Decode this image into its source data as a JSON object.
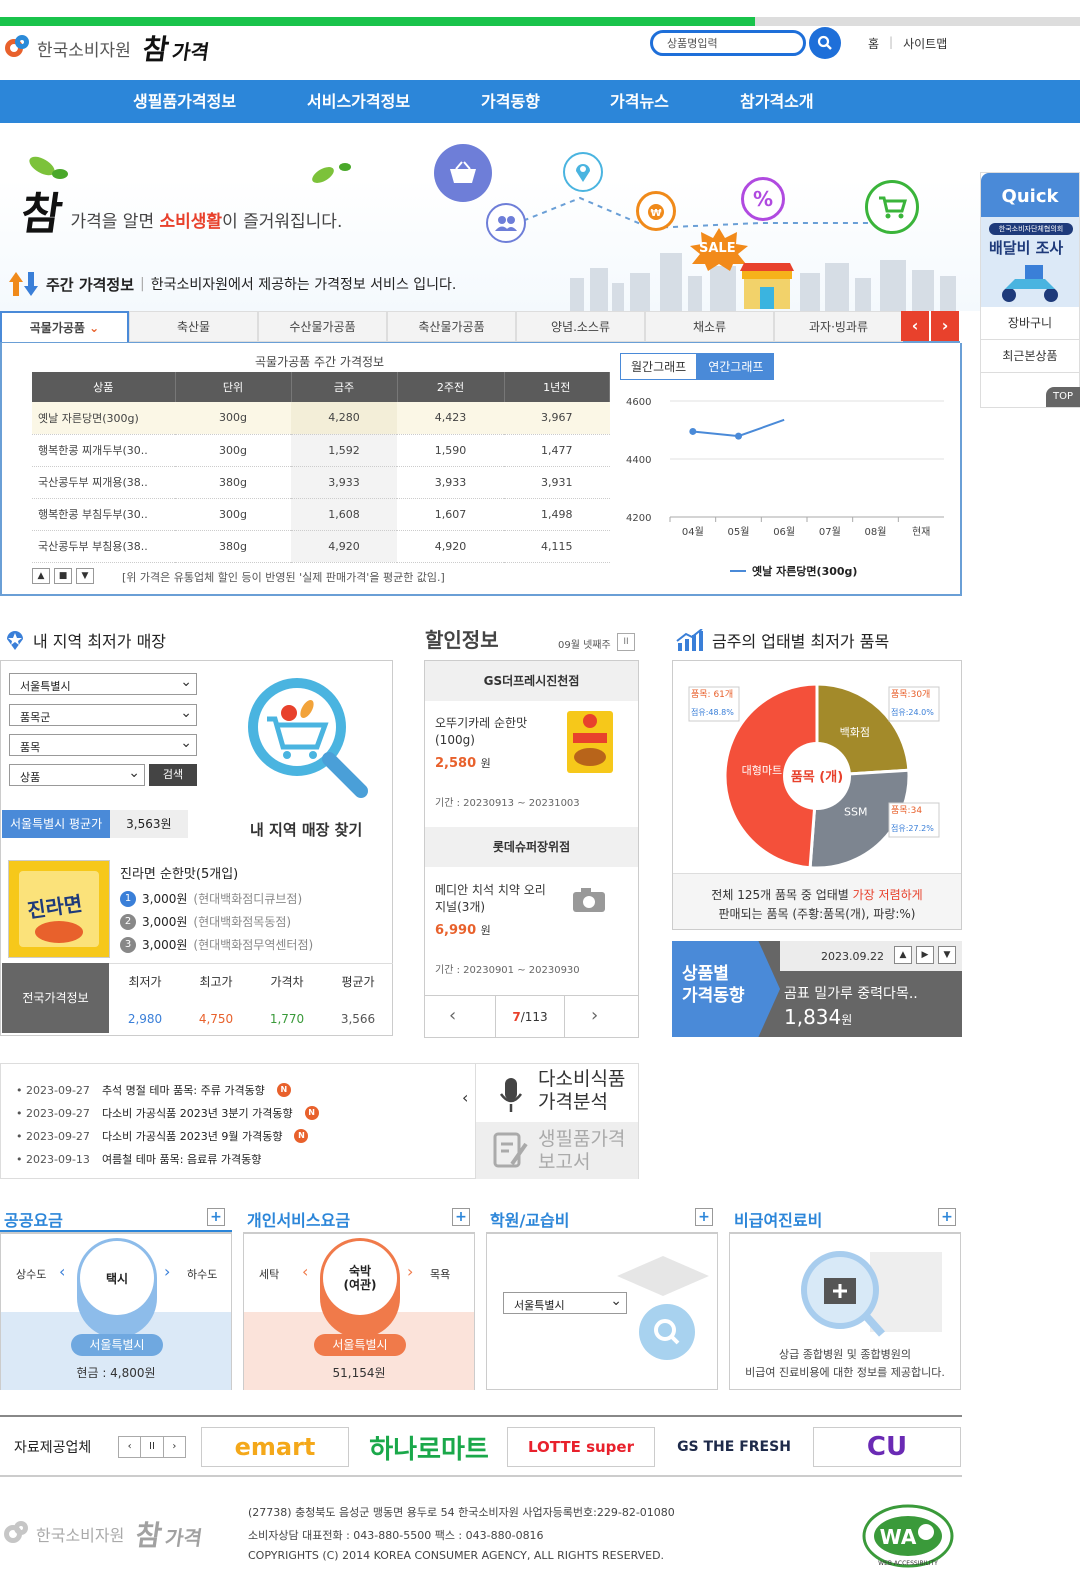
{
  "header": {
    "org_name": "한국소비자원",
    "brand_big": "참",
    "brand_small": "가격",
    "search_placeholder": "상품명입력",
    "links": [
      "홈",
      "사이트맵"
    ]
  },
  "gnb": [
    "생필품가격정보",
    "서비스가격정보",
    "가격동향",
    "가격뉴스",
    "참가격소개"
  ],
  "hero": {
    "slogan_big": "참",
    "slogan_pre": "가격을 알면 ",
    "slogan_em": "소비생활",
    "slogan_post": "이 즐거워집니다.",
    "sale_badge": "SALE",
    "icons": [
      "basket-icon",
      "map-pin-icon",
      "wallet-icon",
      "percent-icon",
      "cart-icon",
      "people-icon"
    ]
  },
  "weekly": {
    "title": "주간 가격정보",
    "desc": "한국소비자원에서 제공하는 가격정보 서비스 입니다."
  },
  "tabs": [
    "곡물가공품",
    "축산물",
    "수산물가공품",
    "축산물가공품",
    "양념.소스류",
    "채소류",
    "과자·빙과류"
  ],
  "price_table": {
    "title": "곡물가공품 주간 가격정보",
    "headers": [
      "상품",
      "단위",
      "금주",
      "2주전",
      "1년전"
    ],
    "rows": [
      [
        "옛날 자른당면(300g)",
        "300g",
        "4,280",
        "4,423",
        "3,967"
      ],
      [
        "행복한콩 찌개두부(30..",
        "300g",
        "1,592",
        "1,590",
        "1,477"
      ],
      [
        "국산콩두부 찌개용(38..",
        "380g",
        "3,933",
        "3,933",
        "3,931"
      ],
      [
        "행복한콩 부침두부(30..",
        "300g",
        "1,608",
        "1,607",
        "1,498"
      ],
      [
        "국산콩두부 부침용(38..",
        "380g",
        "4,920",
        "4,920",
        "4,115"
      ]
    ],
    "note": "[위 가격은 유통업체 할인 등이 반영된 '실제 판매가격'을 평균한 값임.]"
  },
  "graph_tabs": [
    "월간그래프",
    "연간그래프"
  ],
  "chart_data": {
    "type": "line",
    "categories": [
      "04월",
      "05월",
      "06월",
      "07월",
      "08월",
      "현재"
    ],
    "series": [
      {
        "name": "옛날 자른당면(300g)",
        "values": [
          4495,
          4479,
          4535,
          null,
          null,
          null
        ]
      }
    ],
    "yticks": [
      4600,
      4400,
      4200
    ],
    "ylim": [
      4200,
      4600
    ],
    "color": "#4a8ad8",
    "grid": true
  },
  "quick": {
    "title": "Quick",
    "banner_top": "한국소비자단체협의회",
    "banner_main": "배달비 조사",
    "items": [
      "장바구니",
      "최근본상품"
    ],
    "top": "TOP"
  },
  "region": {
    "title": "내 지역 최저가 매장",
    "selects": [
      "서울특별시",
      "품목군",
      "품목",
      "상품"
    ],
    "search_btn": "검색",
    "find_label": "내 지역 매장 찾기",
    "avg_label": "서울특별시 평균가",
    "avg_value": "3,563원",
    "product": "진라면 순한맛(5개입)",
    "pkg_text": "진라면",
    "ranks": [
      {
        "n": "1",
        "price": "3,000원",
        "store": "(현대백화점디큐브점)"
      },
      {
        "n": "2",
        "price": "3,000원",
        "store": "(현대백화점목동점)"
      },
      {
        "n": "3",
        "price": "3,000원",
        "store": "(현대백화점무역센터점)"
      }
    ],
    "nat_label": "전국가격정보",
    "nat_cols": [
      {
        "h": "최저가",
        "v": "2,980",
        "c": "#3a7fd8"
      },
      {
        "h": "최고가",
        "v": "4,750",
        "c": "#e8612c"
      },
      {
        "h": "가격차",
        "v": "1,770",
        "c": "#3a9a3a"
      },
      {
        "h": "평균가",
        "v": "3,566",
        "c": "#555"
      }
    ]
  },
  "sale": {
    "title": "할인정보",
    "week": "09월 넷째주",
    "pause": "II",
    "stores": [
      {
        "name": "GS더프레시진천점",
        "product": "오뚜기카레 순한맛\n(100g)",
        "price": "2,580",
        "unit": "원",
        "period": "기간 : 20230913 ~ 20231003"
      },
      {
        "name": "롯데슈퍼장위점",
        "product": "메디안 치석 치약 오리\n지널(3개)",
        "price": "6,990",
        "unit": "원",
        "period": "기간 : 20230901 ~ 20230930"
      }
    ],
    "page_cur": "7",
    "page_total": "/113"
  },
  "pie": {
    "title": "금주의 업태별 최저가 품목",
    "center": "품목 (개)",
    "segments": [
      {
        "name": "대형마트",
        "count": "품목: 61개",
        "share": "점유:48.8%",
        "value": 48.8,
        "color": "#f4503a"
      },
      {
        "name": "백화점",
        "count": "품목:30개",
        "share": "점유:24.0%",
        "value": 24.0,
        "color": "#a38a2a"
      },
      {
        "name": "SSM",
        "count": "품목:34",
        "share": "점유:27.2%",
        "value": 27.2,
        "color": "#7d8590"
      }
    ],
    "caption1_pre": "전체 125개 품목 중 업태별 ",
    "caption1_em": "가장 저렴하게",
    "caption2": "판매되는 품목 (주황:품목(개), 파랑:%)"
  },
  "trend": {
    "label": "상품별\n가격동향",
    "date": "2023.09.22",
    "product": "곰표 밀가루 중력다목..",
    "price": "1,834",
    "unit": "원"
  },
  "news": {
    "items": [
      {
        "date": "2023-09-27",
        "title": "추석 명절 테마 품목: 주류 가격동향",
        "new": true
      },
      {
        "date": "2023-09-27",
        "title": "다소비 가공식품 2023년 3분기 가격동향",
        "new": true
      },
      {
        "date": "2023-09-27",
        "title": "다소비 가공식품 2023년 9월 가격동향",
        "new": true
      },
      {
        "date": "2023-09-13",
        "title": "여름철 테마 품목: 음료류 가격동향",
        "new": false
      }
    ],
    "new_badge": "N",
    "right1": "다소비식품\n가격분석",
    "right2": "생필품가격\n보고서"
  },
  "fees": [
    {
      "title": "공공요금",
      "left": "상수도",
      "center": "택시",
      "right": "하수도",
      "region": "서울특별시",
      "value": "현금 : 4,800원",
      "color": "#6fa8e0",
      "bg": "#dbe9f7"
    },
    {
      "title": "개인서비스요금",
      "left": "세탁",
      "center": "숙박\n(여관)",
      "right": "목욕",
      "region": "서울특별시",
      "value": "51,154원",
      "color": "#f07a4a",
      "bg": "#fbe3da"
    },
    {
      "title": "학원/교습비",
      "select": "서울특별시"
    },
    {
      "title": "비급여진료비",
      "desc1": "상급 종합병원 및 종합병원의",
      "desc2": "비급여 진료비용에 대한 정보를 제공합니다."
    }
  ],
  "partners": {
    "label": "자료제공업체",
    "logos": [
      "emart",
      "하나로마트",
      "LOTTE super",
      "GS THE FRESH",
      "CU"
    ]
  },
  "footer": {
    "org": "한국소비자원",
    "brand_big": "참",
    "brand_small": "가격",
    "line1": "(27738) 충청북도 음성군 맹동면 용두로 54 한국소비자원 사업자등록번호:229-82-01080",
    "line2": "소비자상담 대표전화 : 043-880-5500 팩스 : 043-880-0816",
    "line3": "COPYRIGHTS (C) 2014 KOREA CONSUMER AGENCY, ALL RIGHTS RESERVED.",
    "wa_mark": "WA",
    "wa_text": "WEB ACCESSIBILITY"
  }
}
